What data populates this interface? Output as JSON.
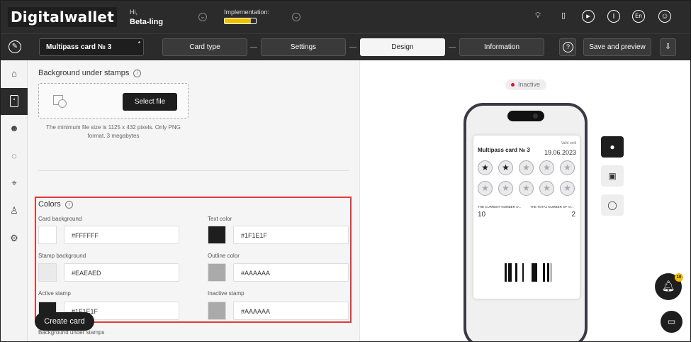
{
  "app": {
    "logo": "Digitalwallet"
  },
  "header": {
    "greeting": "Hi,",
    "user_name": "Beta-ling",
    "implementation_label": "Implementation:",
    "implementation_progress": 0.85,
    "language": "En"
  },
  "toolbar": {
    "card_name": "Multipass card № 3",
    "card_name_marker": "*",
    "steps": [
      {
        "label": "Card type"
      },
      {
        "label": "Settings"
      },
      {
        "label": "Design"
      },
      {
        "label": "Information"
      }
    ],
    "active_step": "Design",
    "help_icon": "?",
    "save_label": "Save and preview"
  },
  "editor": {
    "background_title": "Background under stamps",
    "select_file": "Select file",
    "file_hint": "The minimum file size is 1125 x 432 pixels. Only PNG format. 3 megabytes",
    "colors_title": "Colors",
    "fields": [
      {
        "label": "Card background",
        "value": "#FFFFFF",
        "swatch": "#FFFFFF"
      },
      {
        "label": "Text color",
        "value": "#1F1E1F",
        "swatch": "#1F1E1F"
      },
      {
        "label": "Stamp background",
        "value": "#EAEAED",
        "swatch": "#EAEAED"
      },
      {
        "label": "Outline color",
        "value": "#AAAAAA",
        "swatch": "#AAAAAA"
      },
      {
        "label": "Active stamp",
        "value": "#1F1E1F",
        "swatch": "#1F1E1F"
      },
      {
        "label": "Inactive stamp",
        "value": "#AAAAAA",
        "swatch": "#AAAAAA"
      }
    ],
    "create_card": "Create card",
    "next_section": "Background under stamps"
  },
  "preview": {
    "status": "Inactive",
    "card": {
      "name": "Multipass card № 3",
      "valid_label": "Valid until",
      "valid_date": "19.06.2023",
      "active_stamps": 2,
      "total_stamps": 10,
      "current_label": "THE CURRENT NUMBER O...",
      "current_value": "10",
      "total_label": "THE TOTAL NUMBER OF VI...",
      "total_value": "2"
    },
    "notification_count": "10"
  }
}
